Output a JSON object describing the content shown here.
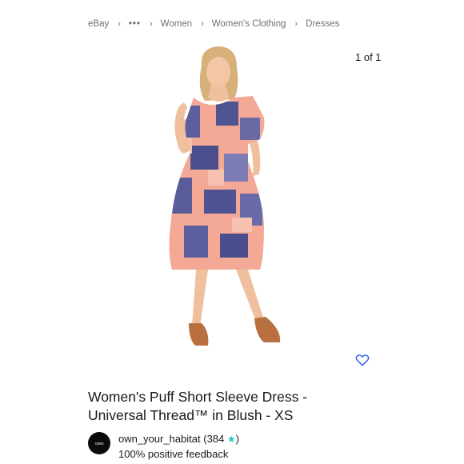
{
  "breadcrumb": {
    "items": [
      "eBay",
      "•••",
      "Women",
      "Women's Clothing",
      "Dresses"
    ]
  },
  "gallery": {
    "counter": "1 of 1"
  },
  "product": {
    "title_line1": "Women's Puff Short Sleeve Dress -",
    "title_line2": "Universal Thread™ in Blush - XS"
  },
  "seller": {
    "avatar_text": "OWN",
    "name": "own_your_habitat",
    "score_open": " (384 ",
    "score_close": ")",
    "feedback": "100% positive feedback"
  },
  "icons": {
    "watch": "heart-icon",
    "rating": "star-icon",
    "separator": "chevron-right-icon"
  },
  "colors": {
    "accent": "#3665f3",
    "star": "#20c7c1"
  }
}
